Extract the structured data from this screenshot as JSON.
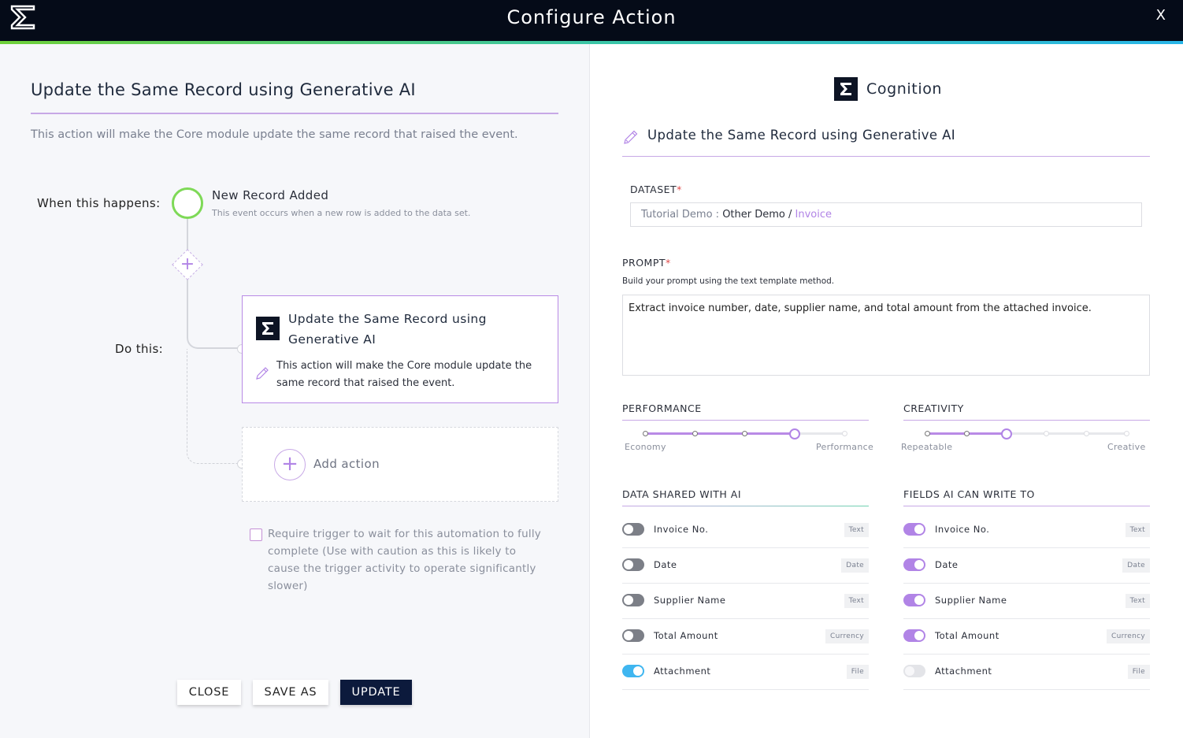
{
  "header": {
    "title": "Configure Action",
    "close_label": "X"
  },
  "left": {
    "title": "Update the Same Record using Generative AI",
    "description": "This action will make the Core module update the same record that raised the event.",
    "when_label": "When this happens:",
    "do_label": "Do this:",
    "trigger": {
      "name": "New Record Added",
      "description": "This event occurs when a new row is added to the data set."
    },
    "action_card": {
      "title": "Update the Same Record using Generative AI",
      "description": "This action will make the Core module update the same record that raised the event."
    },
    "add_action_label": "Add action",
    "require_wait_text": "Require trigger to wait for this automation to fully complete (Use with caution as this is likely to cause the trigger activity to operate significantly slower)",
    "buttons": {
      "close": "CLOSE",
      "save_as": "SAVE AS",
      "update": "UPDATE"
    }
  },
  "right": {
    "brand": "Cognition",
    "title": "Update the Same Record using Generative AI",
    "dataset": {
      "label": "DATASET",
      "required": "*",
      "part1": "Tutorial Demo : ",
      "part2": "Other Demo / ",
      "part3": "Invoice"
    },
    "prompt": {
      "label": "PROMPT",
      "required": "*",
      "hint": "Build your prompt using the text template method.",
      "value": "Extract invoice number, date, supplier name, and total amount from the attached invoice."
    },
    "performance": {
      "label": "PERFORMANCE",
      "min_label": "Economy",
      "max_label": "Performance",
      "level": 3,
      "steps": 5
    },
    "creativity": {
      "label": "CREATIVITY",
      "min_label": "Repeatable",
      "max_label": "Creative",
      "level": 2,
      "steps": 6
    },
    "shared": {
      "label": "DATA SHARED WITH AI",
      "fields": [
        {
          "name": "Invoice No.",
          "type": "Text",
          "enabled": false
        },
        {
          "name": "Date",
          "type": "Date",
          "enabled": false
        },
        {
          "name": "Supplier Name",
          "type": "Text",
          "enabled": false
        },
        {
          "name": "Total Amount",
          "type": "Currency",
          "enabled": false
        },
        {
          "name": "Attachment",
          "type": "File",
          "enabled": true
        }
      ]
    },
    "writable": {
      "label": "FIELDS AI CAN WRITE TO",
      "fields": [
        {
          "name": "Invoice No.",
          "type": "Text",
          "enabled": true
        },
        {
          "name": "Date",
          "type": "Date",
          "enabled": true
        },
        {
          "name": "Supplier Name",
          "type": "Text",
          "enabled": true
        },
        {
          "name": "Total Amount",
          "type": "Currency",
          "enabled": true
        },
        {
          "name": "Attachment",
          "type": "File",
          "enabled": false
        }
      ]
    }
  }
}
